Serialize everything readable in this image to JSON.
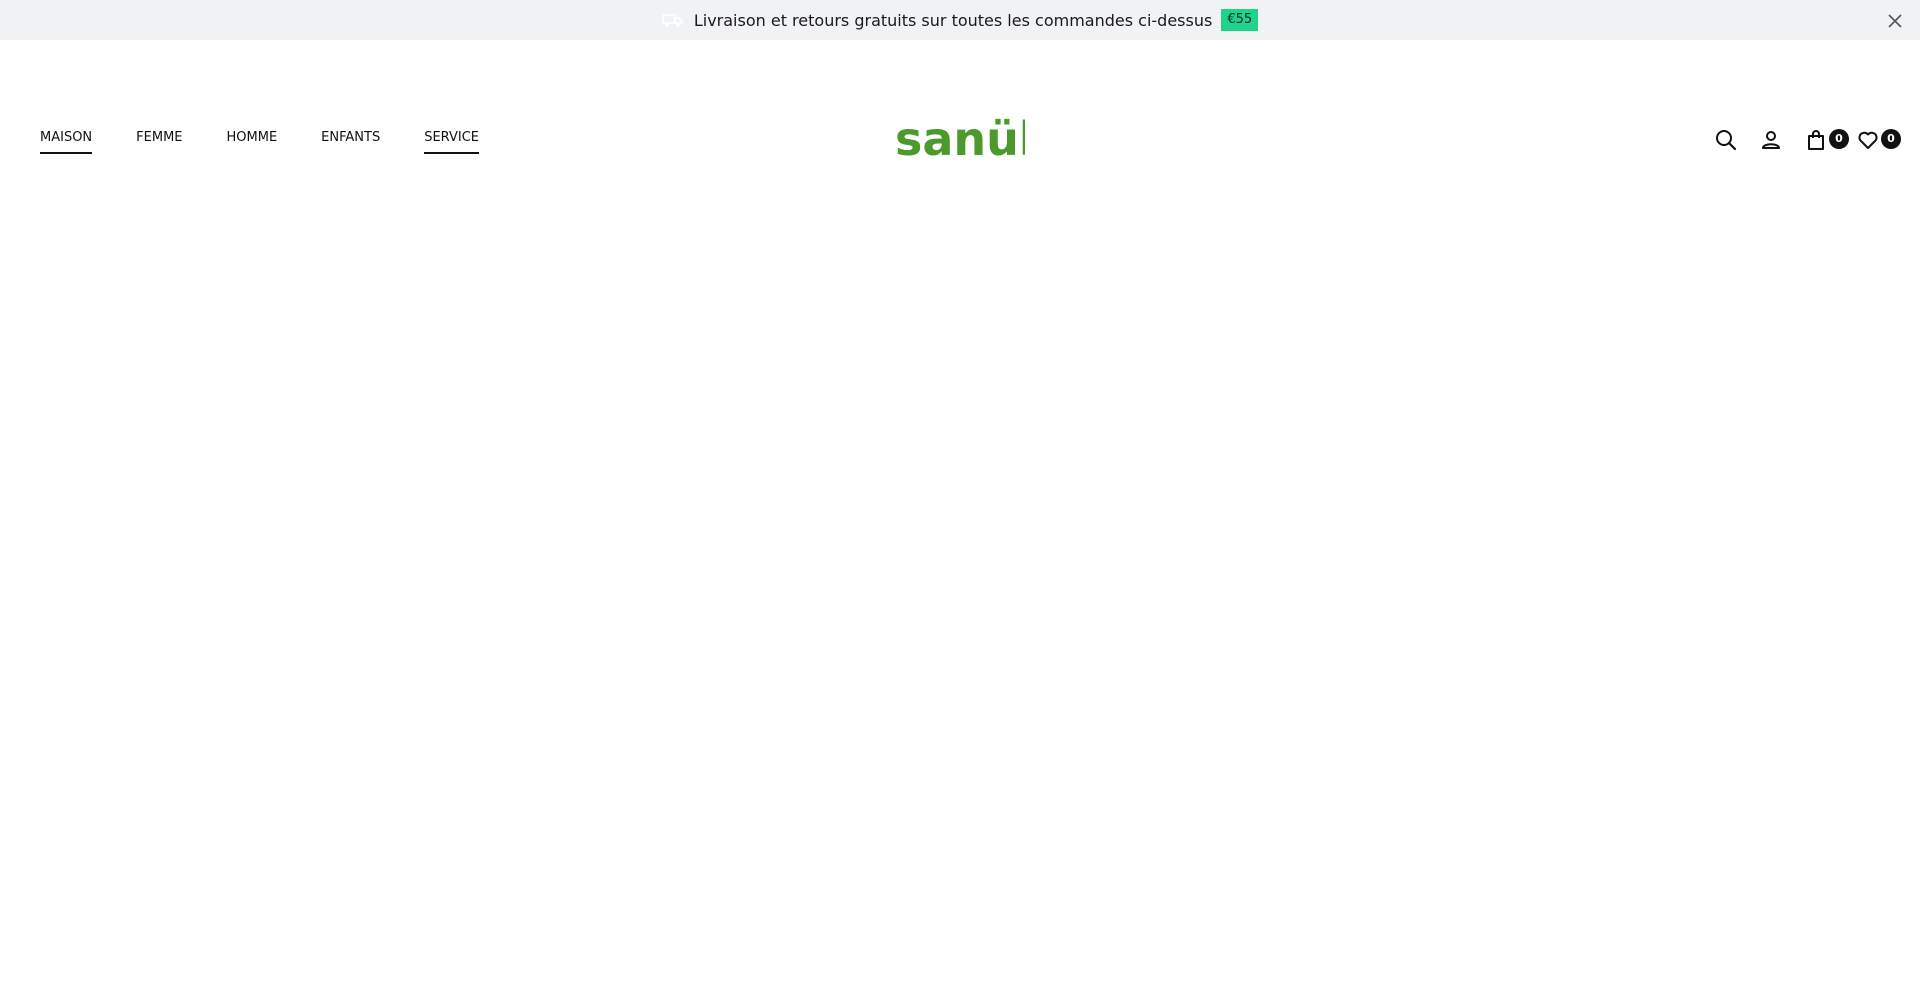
{
  "announcement": {
    "icon": "truck-icon",
    "text": "Livraison et retours gratuits sur toutes les commandes ci-dessus",
    "badge": "€55",
    "badge_color": "#1fd38c",
    "close_icon": "close-icon"
  },
  "nav": {
    "items": [
      {
        "label": "MAISON"
      },
      {
        "label": "FEMME"
      },
      {
        "label": "HOMME"
      },
      {
        "label": "ENFANTS"
      },
      {
        "label": "SERVICE"
      }
    ]
  },
  "logo": {
    "text": "sanük",
    "color": "#4d9a2c"
  },
  "tools": {
    "search_icon": "search-icon",
    "account_icon": "user-icon",
    "cart_icon": "shopping-bag-icon",
    "cart_count": "0",
    "wishlist_icon": "heart-icon",
    "wishlist_count": "0"
  }
}
